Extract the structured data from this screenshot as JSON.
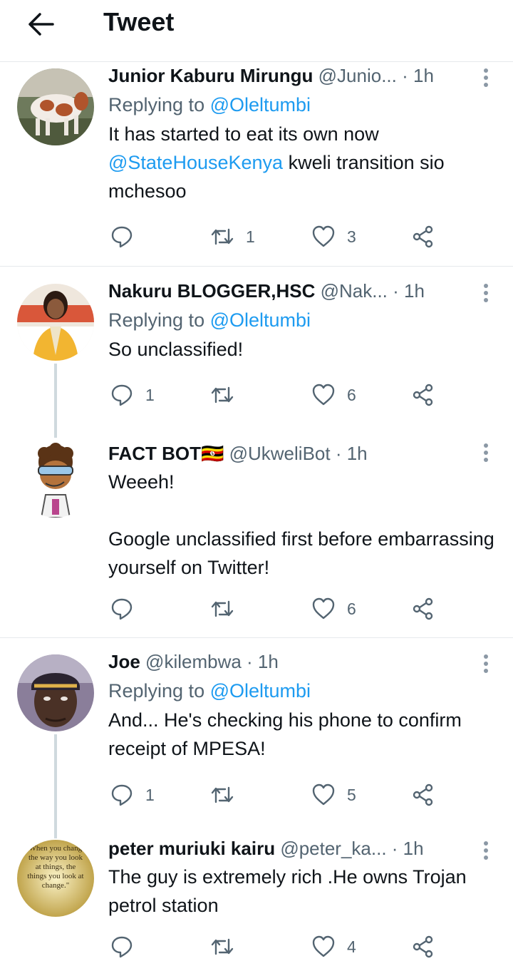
{
  "header": {
    "title": "Tweet"
  },
  "tweets": [
    {
      "name": "Junior Kaburu Mirungu",
      "handle": "@Junio...",
      "time": "· 1h",
      "reply_prefix": "Replying to ",
      "reply_to": "@Oleltumbi",
      "mention": "@StateHouseKenya",
      "text_before": "It has started to eat its own now",
      "text_after": "  kweli transition sio mchesoo",
      "replies": "",
      "retweets": "1",
      "likes": "3"
    },
    {
      "name": "Nakuru BLOGGER,HSC",
      "handle": "@Nak...",
      "time": "· 1h",
      "reply_prefix": "Replying to ",
      "reply_to": "@Oleltumbi",
      "text": "So unclassified!",
      "replies": "1",
      "retweets": "",
      "likes": "6"
    },
    {
      "name": "FACT BOT",
      "flag": "🇺🇬",
      "handle": "@UkweliBot",
      "time": "· 1h",
      "text_line1": "Weeeh!",
      "text_line2": "Google unclassified first before embarrassing yourself on Twitter!",
      "replies": "",
      "retweets": "",
      "likes": "6"
    },
    {
      "name": "Joe",
      "handle": "@kilembwa",
      "time": "· 1h",
      "reply_prefix": "Replying to ",
      "reply_to": "@Oleltumbi",
      "text": "And... He's checking his phone to confirm receipt of MPESA!",
      "replies": "1",
      "retweets": "",
      "likes": "5"
    },
    {
      "name": "peter muriuki kairu",
      "handle": "@peter_ka...",
      "time": "· 1h",
      "text": "The guy is extremely rich .He owns Trojan petrol station",
      "avatar_quote": "\"When you change the way you look at things, the things you look at change.\"",
      "replies": "",
      "retweets": "",
      "likes": "4"
    }
  ],
  "icons": {
    "back": "arrow-left-icon",
    "more": "more-vertical-icon",
    "reply": "reply-bubble-icon",
    "retweet": "retweet-icon",
    "like": "heart-icon",
    "share": "share-icon"
  },
  "colors": {
    "accent": "#1d9bf0",
    "muted": "#536471",
    "text": "#0f1419",
    "divider": "#e6e9ec"
  }
}
